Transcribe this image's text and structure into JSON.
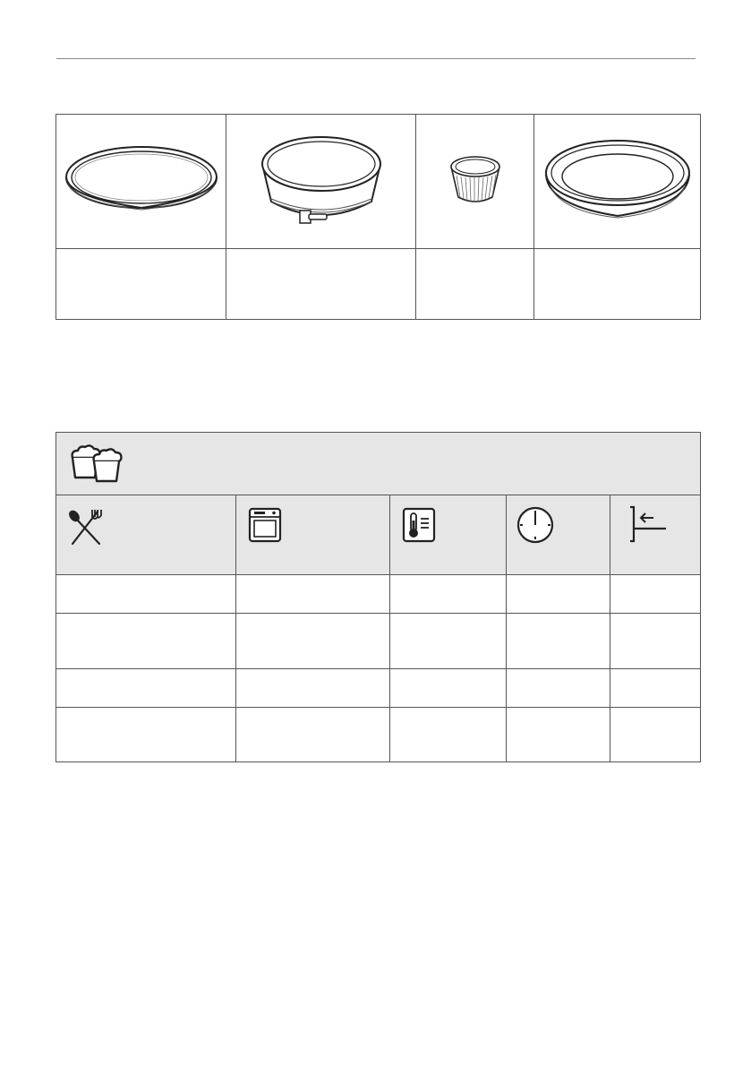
{
  "icons": {
    "cookware": [
      "flan-tin-icon",
      "springform-tin-icon",
      "ramekin-icon",
      "round-baking-tin-icon"
    ],
    "category": "muffins-icon",
    "columns": [
      "food-utensils-icon",
      "oven-function-icon",
      "temperature-icon",
      "time-icon",
      "shelf-position-icon"
    ]
  },
  "cookware_captions": [
    "",
    "",
    "",
    ""
  ],
  "baking_rows": [
    [
      "",
      "",
      "",
      "",
      ""
    ],
    [
      "",
      "",
      "",
      "",
      ""
    ],
    [
      "",
      "",
      "",
      "",
      ""
    ],
    [
      "",
      "",
      "",
      "",
      ""
    ]
  ]
}
